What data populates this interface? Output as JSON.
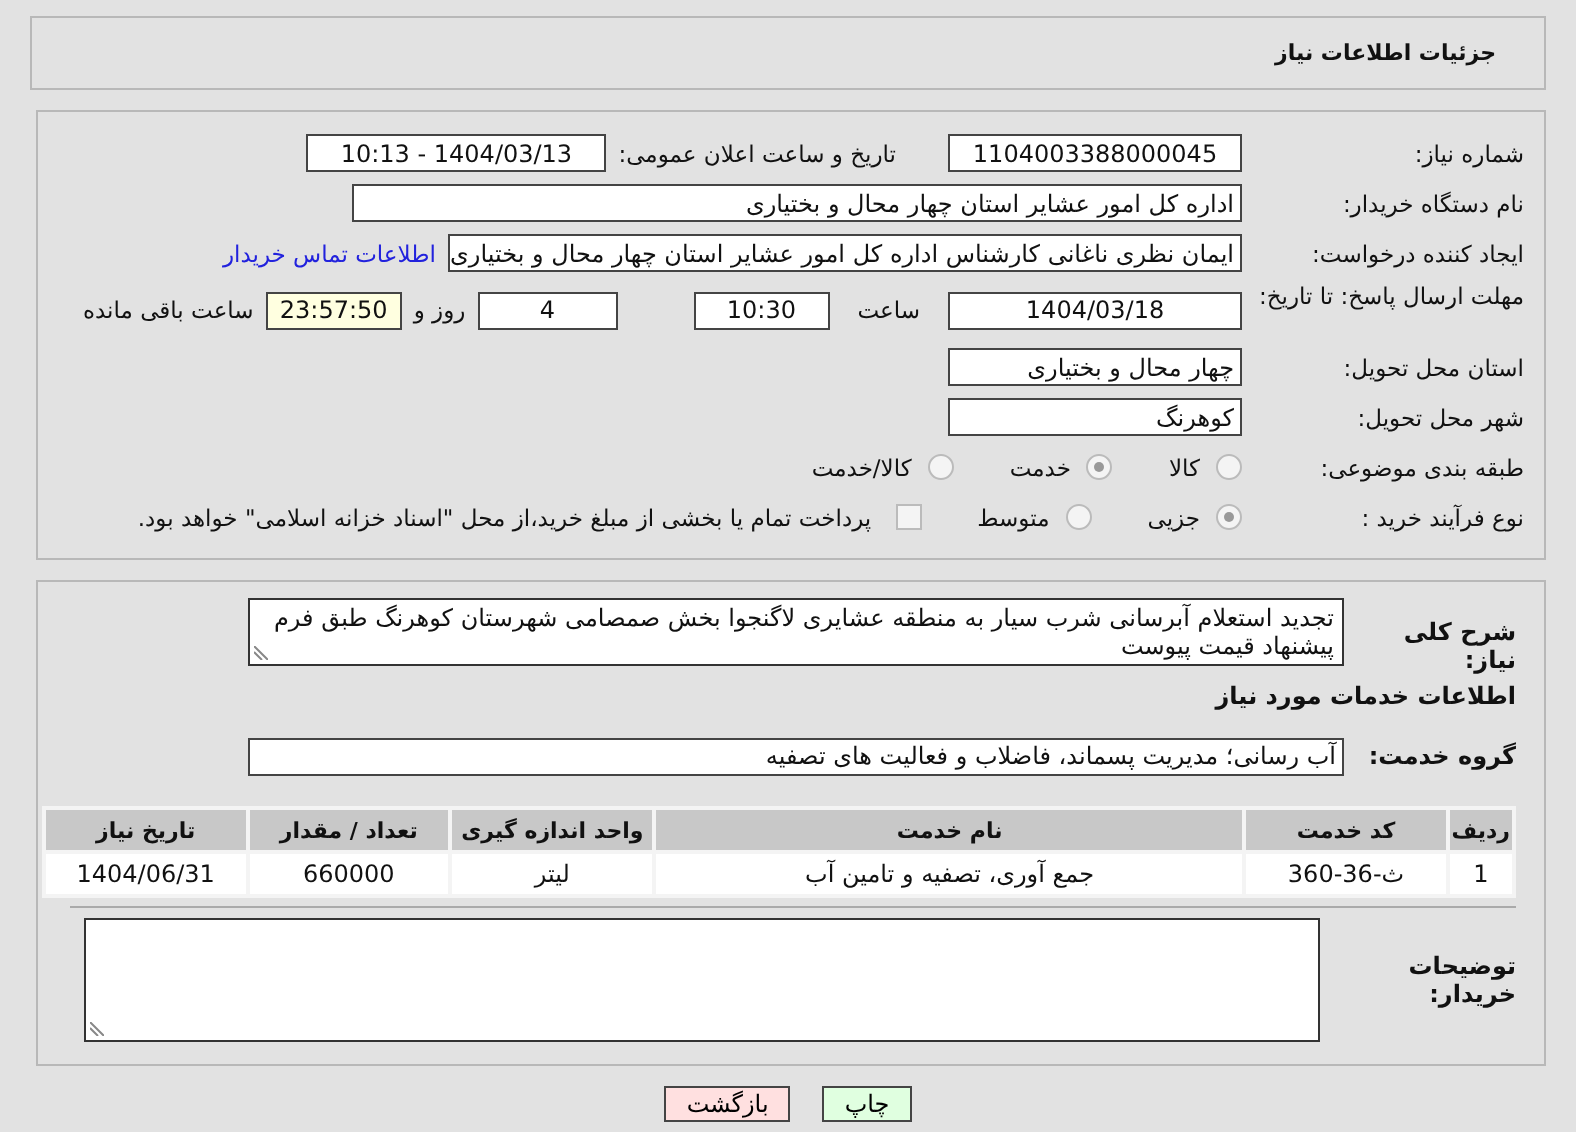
{
  "header": {
    "title": "جزئیات اطلاعات نیاز"
  },
  "details": {
    "need_number": {
      "label": "شماره نیاز:",
      "value": "1104003388000045"
    },
    "announce": {
      "label": "تاریخ و ساعت اعلان عمومی:",
      "value": "1404/03/13 - 10:13"
    },
    "buyer": {
      "label": "نام دستگاه خریدار:",
      "value": "اداره کل امور عشایر استان چهار محال و بختیاری"
    },
    "creator": {
      "label": "ایجاد کننده درخواست:",
      "value": "ایمان نظری ناغانی کارشناس اداره کل امور عشایر استان چهار محال و بختیاری",
      "link": "اطلاعات تماس خریدار"
    },
    "deadline": {
      "label": "مهلت ارسال پاسخ: تا تاریخ:",
      "date": "1404/03/18",
      "time_label": "ساعت",
      "time": "10:30",
      "days": "4",
      "days_label": "روز و",
      "remaining": "23:57:50",
      "remaining_label": "ساعت باقی مانده"
    },
    "province": {
      "label": "استان محل تحویل:",
      "value": "چهار محال و بختیاری"
    },
    "city": {
      "label": "شهر محل تحویل:",
      "value": "کوهرنگ"
    },
    "category": {
      "label": "طبقه بندی موضوعی:",
      "options": [
        {
          "label": "کالا",
          "selected": false
        },
        {
          "label": "خدمت",
          "selected": true
        },
        {
          "label": "کالا/خدمت",
          "selected": false
        }
      ]
    },
    "process": {
      "label": "نوع فرآیند خرید :",
      "options": [
        {
          "label": "جزیی",
          "selected": true
        },
        {
          "label": "متوسط",
          "selected": false
        }
      ],
      "payment": {
        "checked": false,
        "label": "پرداخت تمام یا بخشی از مبلغ خرید،از محل \"اسناد خزانه اسلامی\" خواهد بود."
      }
    }
  },
  "services": {
    "summary": {
      "label": "شرح کلی نیاز:",
      "value": "تجدید استعلام آبرسانی شرب سیار به منطقه عشایری لاگنجوا بخش صمصامی شهرستان کوهرنگ طبق فرم پیشنهاد قیمت پیوست"
    },
    "heading": "اطلاعات خدمات مورد نیاز",
    "group": {
      "label": "گروه خدمت:",
      "value": "آب رسانی؛ مدیریت پسماند، فاضلاب و فعالیت های تصفیه"
    },
    "table": {
      "columns": [
        "ردیف",
        "کد خدمت",
        "نام خدمت",
        "واحد اندازه گیری",
        "تعداد / مقدار",
        "تاریخ نیاز"
      ],
      "rows": [
        [
          "1",
          "ث-36-360",
          "جمع آوری، تصفیه و تامین آب",
          "لیتر",
          "660000",
          "1404/06/31"
        ]
      ]
    },
    "notes": {
      "label": "توضیحات خریدار:"
    }
  },
  "buttons": [
    {
      "label": "چاپ",
      "kind": "print"
    },
    {
      "label": "بازگشت",
      "kind": "back"
    }
  ]
}
